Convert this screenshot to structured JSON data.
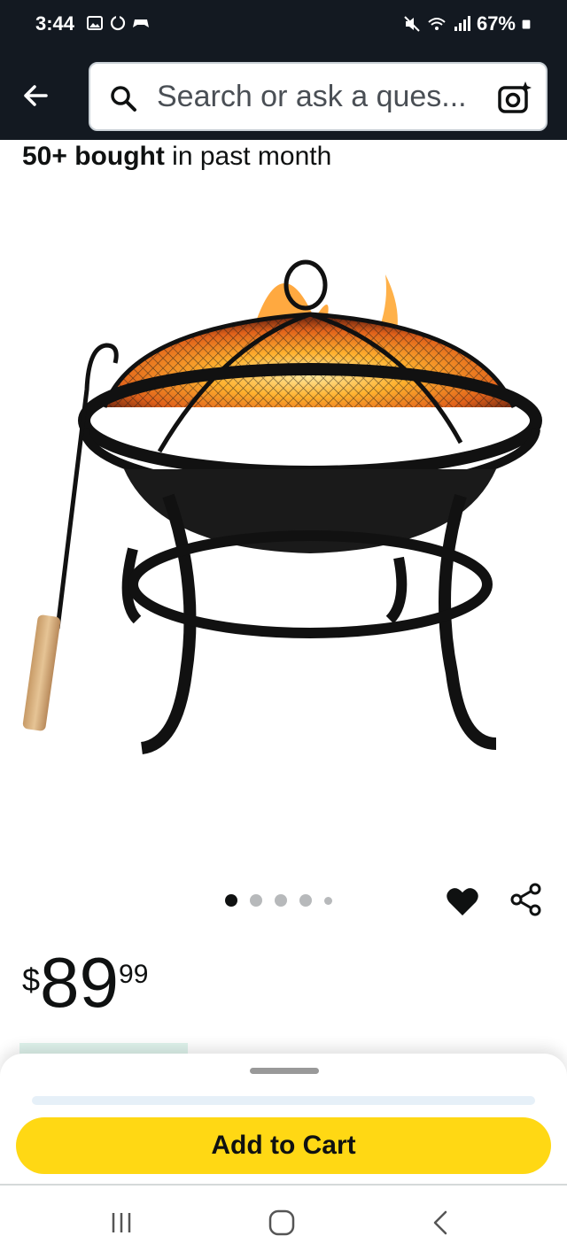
{
  "status_bar": {
    "time": "3:44",
    "battery": "67%"
  },
  "header": {
    "search_placeholder": "Search or ask a ques..."
  },
  "product": {
    "bought_count": "50+ bought",
    "bought_suffix": " in past month",
    "image_icon": "fire-pit-with-poker",
    "carousel": {
      "total": 5,
      "active_index": 0
    },
    "price": {
      "currency": "$",
      "whole": "89",
      "fraction": "99"
    }
  },
  "actions": {
    "add_to_cart_label": "Add to Cart"
  },
  "colors": {
    "header_bg": "#131921",
    "cart_button": "#ffd814"
  }
}
